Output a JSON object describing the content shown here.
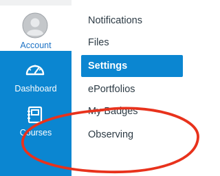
{
  "nav": {
    "account_label": "Account",
    "dashboard_label": "Dashboard",
    "courses_label": "Courses",
    "icons": {
      "account": "user-avatar-icon",
      "dashboard": "speedometer-icon",
      "courses": "book-icon"
    },
    "colors": {
      "nav_bg": "#0b86d1",
      "nav_text": "#ffffff",
      "account_text": "#1c72c5"
    }
  },
  "menu": {
    "items": [
      {
        "label": "Notifications",
        "active": false
      },
      {
        "label": "Files",
        "active": false
      },
      {
        "label": "Settings",
        "active": true
      },
      {
        "label": "ePortfolios",
        "active": false
      },
      {
        "label": "My Badges",
        "active": false
      },
      {
        "label": "Observing",
        "active": false
      }
    ],
    "colors": {
      "active_bg": "#0b86d1",
      "item_text": "#2d3b45"
    }
  },
  "annotation": {
    "shape": "ellipse",
    "color": "#e8321c",
    "highlights": "Observing"
  }
}
